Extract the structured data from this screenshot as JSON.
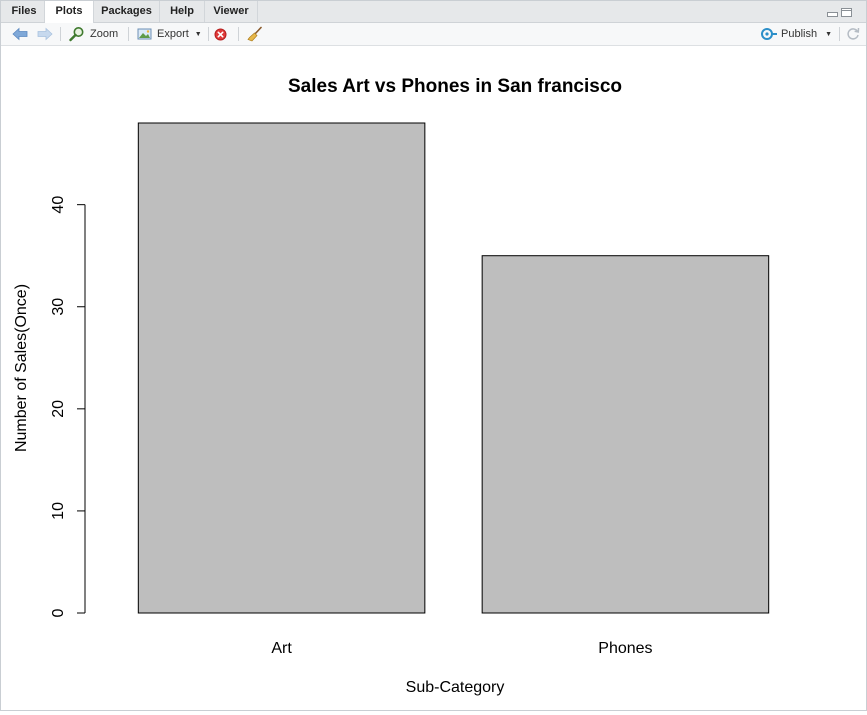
{
  "tabs": [
    {
      "label": "Files",
      "active": false
    },
    {
      "label": "Plots",
      "active": true
    },
    {
      "label": "Packages",
      "active": false
    },
    {
      "label": "Help",
      "active": false
    },
    {
      "label": "Viewer",
      "active": false
    }
  ],
  "toolbar": {
    "zoom_label": "Zoom",
    "export_label": "Export",
    "publish_label": "Publish"
  },
  "chart_data": {
    "type": "bar",
    "title": "Sales Art vs Phones in San francisco",
    "xlabel": "Sub-Category",
    "ylabel": "Number of Sales(Once)",
    "categories": [
      "Art",
      "Phones"
    ],
    "values": [
      48,
      35
    ],
    "ylim": [
      0,
      48
    ],
    "yticks": [
      0,
      10,
      20,
      30,
      40
    ],
    "bar_color": "#bebebe",
    "grid": false
  }
}
